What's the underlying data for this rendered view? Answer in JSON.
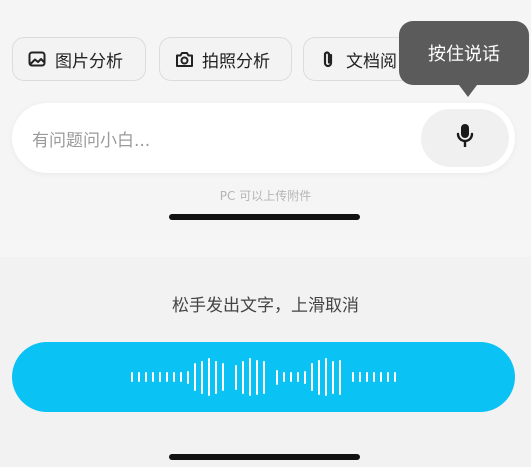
{
  "chips": [
    {
      "label": "图片分析",
      "icon": "image-icon"
    },
    {
      "label": "拍照分析",
      "icon": "camera-icon"
    },
    {
      "label": "文档阅",
      "icon": "paperclip-icon"
    }
  ],
  "tooltip": {
    "text": "按住说话"
  },
  "input": {
    "placeholder": "有问题问小白...",
    "mic_icon": "microphone-icon"
  },
  "attach_hint": "PC 可以上传附件",
  "release_hint": "松手发出文字，上滑取消",
  "voice": {
    "color": "#0bc2f5",
    "waveform_levels": [
      0.2,
      0.2,
      0.2,
      0.2,
      0.2,
      0.2,
      0.2,
      0.2,
      0.25,
      0.55,
      0.65,
      0.75,
      0.65,
      0.55,
      0.5,
      0.65,
      0.75,
      0.7,
      0.65,
      0.3,
      0.2,
      0.2,
      0.2,
      0.25,
      0.55,
      0.7,
      0.75,
      0.65,
      0.7,
      0.2,
      0.2,
      0.2,
      0.2,
      0.2,
      0.2,
      0.2
    ],
    "waveform_gaps_after": [
      13,
      18,
      28
    ]
  }
}
